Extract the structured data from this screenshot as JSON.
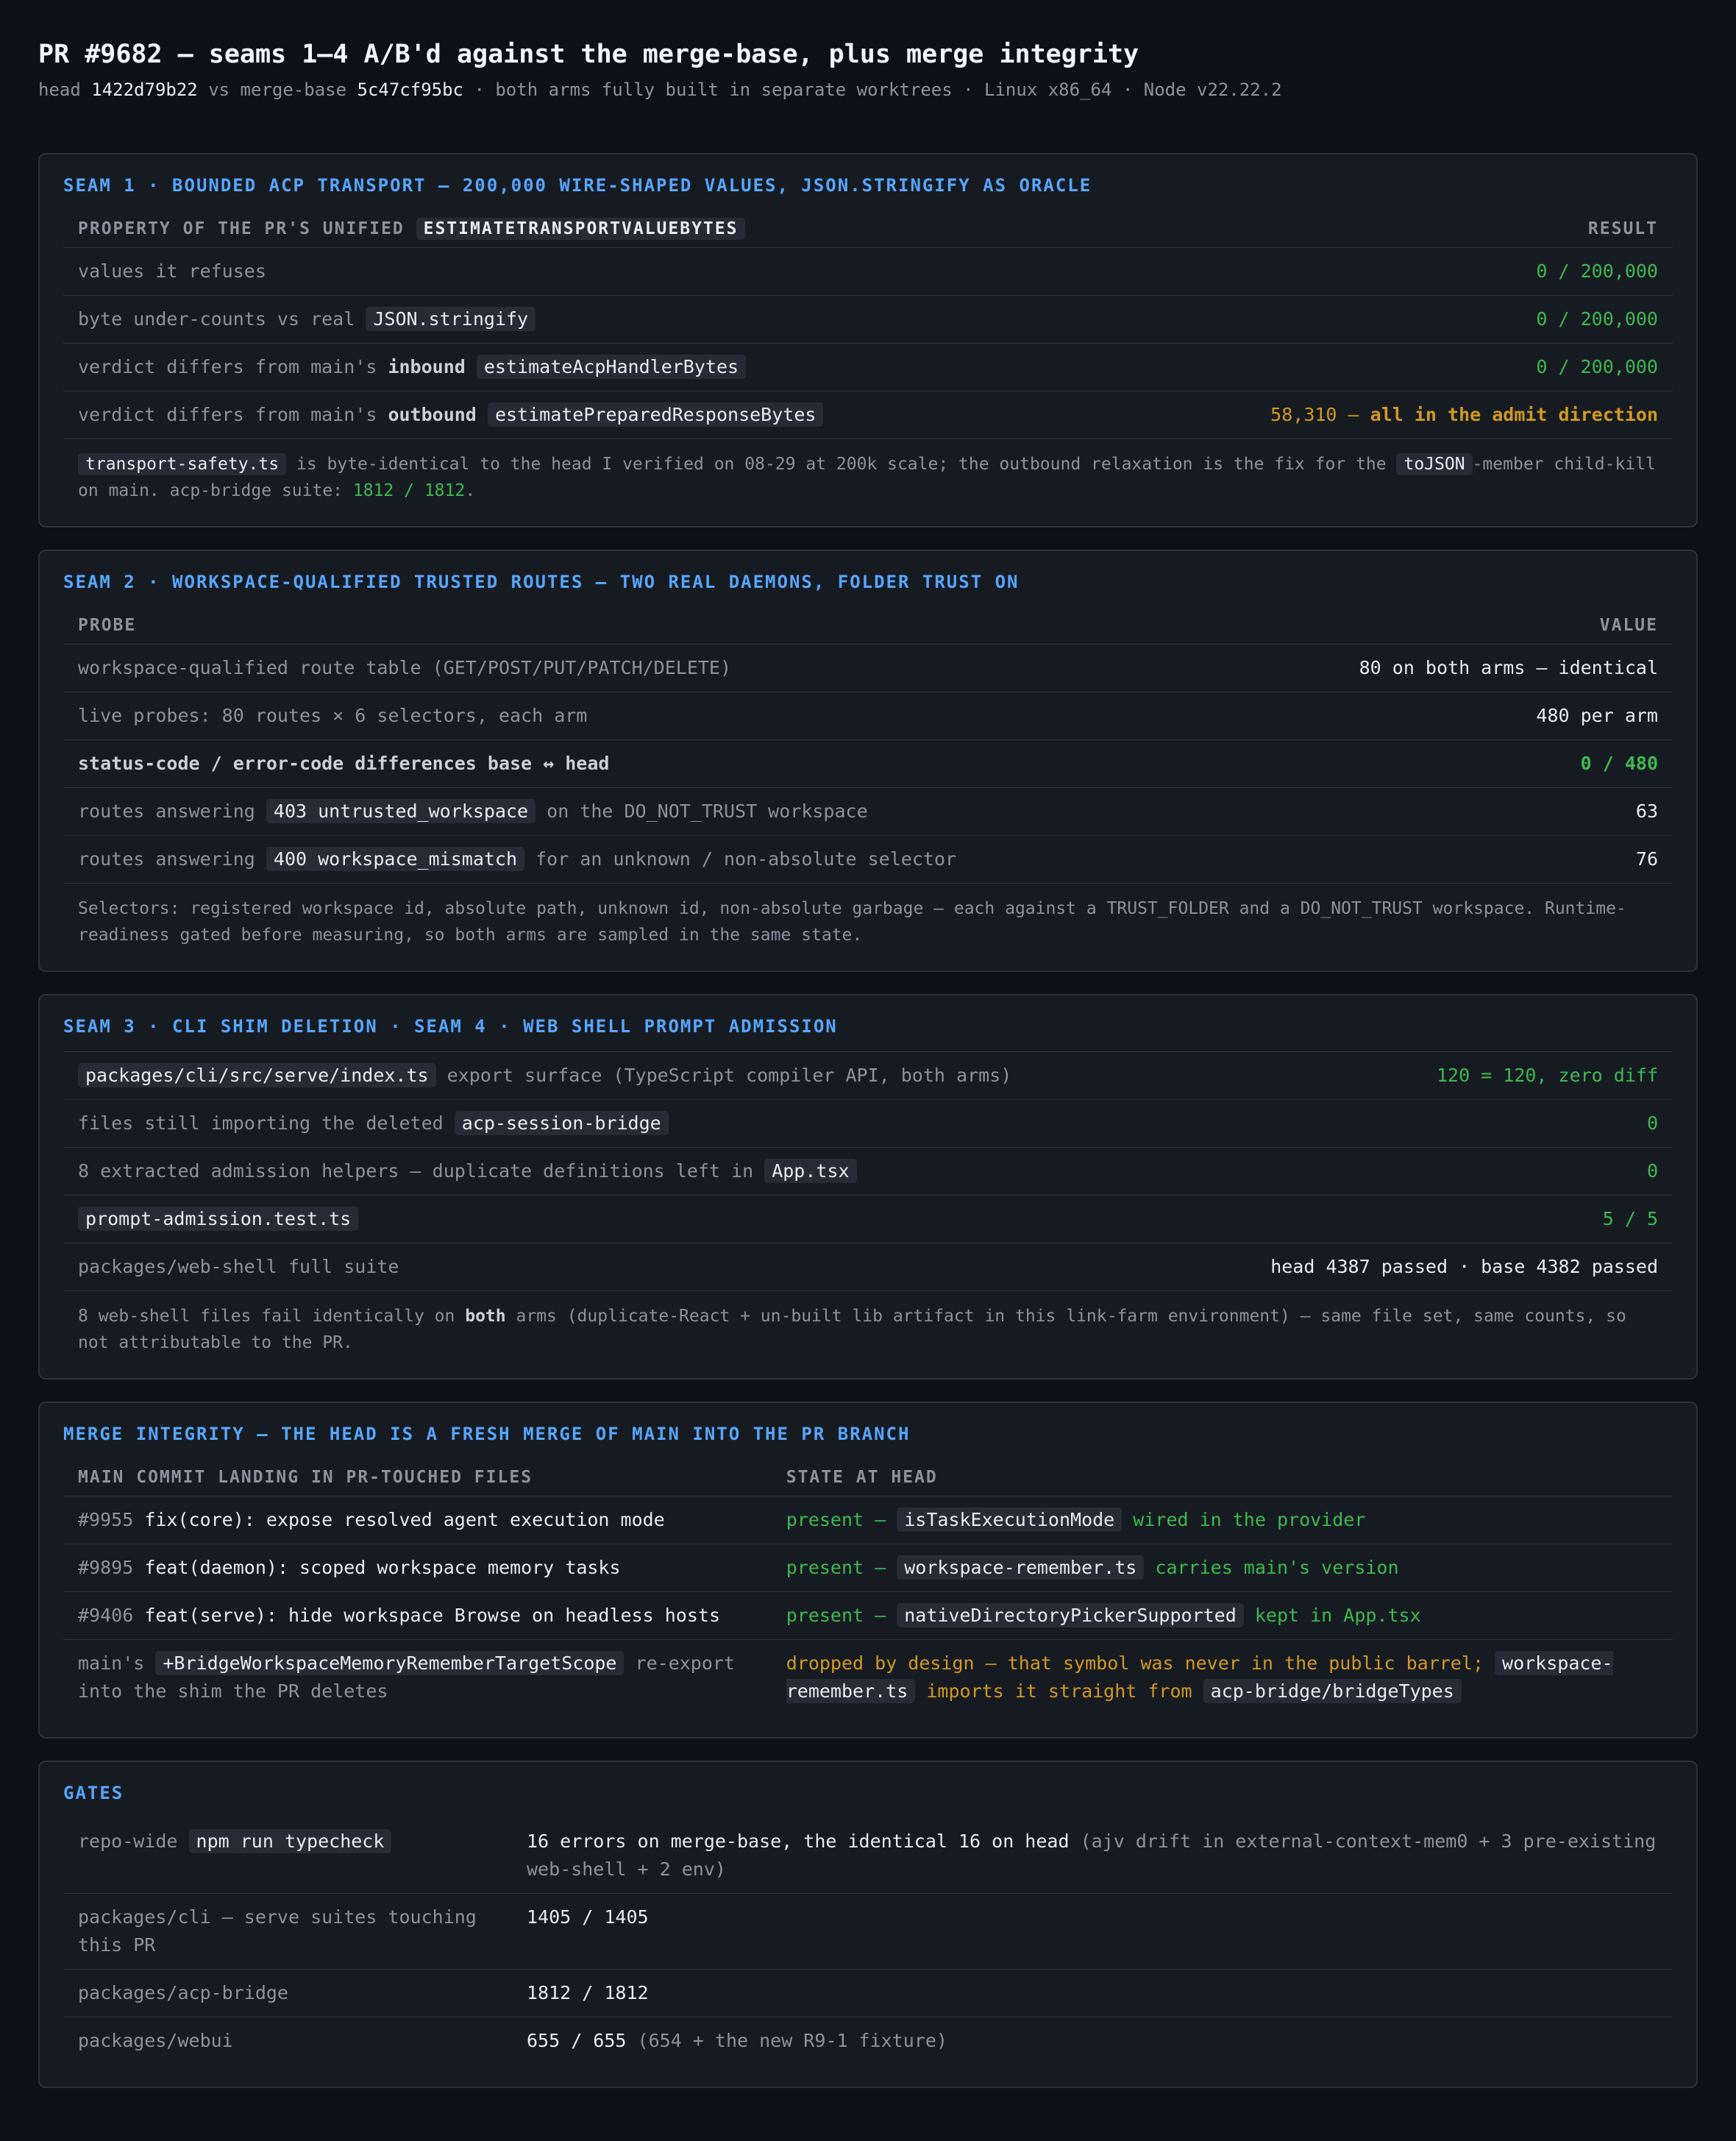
{
  "header": {
    "title": "PR #9682 — seams 1–4 A/B'd against the merge-base, plus merge integrity",
    "sub_head_label": "head",
    "head_sha": "1422d79b22",
    "sub_vs": "vs merge-base",
    "base_sha": "5c47cf95bc",
    "sub_rest": "· both arms fully built in separate worktrees · Linux x86_64 · Node v22.22.2"
  },
  "seam1": {
    "title": "Seam 1 · bounded ACP transport — 200,000 wire-shaped values, JSON.stringify as oracle",
    "col_prop_prefix": "Property of the PR's unified",
    "col_prop_code": "estimateTransportValueBytes",
    "col_result": "Result",
    "rows": [
      {
        "label": "values it refuses",
        "result": "0 / 200,000"
      },
      {
        "label": "byte under-counts vs real",
        "code": "JSON.stringify",
        "result": "0 / 200,000"
      },
      {
        "label_pre": "verdict differs from main's",
        "label_bold": "inbound",
        "code": "estimateAcpHandlerBytes",
        "result": "0 / 200,000"
      },
      {
        "label_pre": "verdict differs from main's",
        "label_bold": "outbound",
        "code": "estimatePreparedResponseBytes",
        "result_pre": "58,310 —",
        "result_bold": "all in the admit direction"
      }
    ],
    "note": {
      "code1": "transport-safety.ts",
      "text1": "is byte-identical to the head I verified on 08-29 at 200k scale; the outbound relaxation is the fix for the",
      "code2": "toJSON",
      "text2": "-member child-kill on main. acp-bridge suite:",
      "suite": "1812 / 1812",
      "end": "."
    }
  },
  "seam2": {
    "title": "Seam 2 · workspace-qualified trusted routes — two real daemons, folder trust on",
    "col_probe": "Probe",
    "col_value": "Value",
    "rows": [
      {
        "label": "workspace-qualified route table (GET/POST/PUT/PATCH/DELETE)",
        "value": "80 on both arms — identical"
      },
      {
        "label": "live probes: 80 routes × 6 selectors, each arm",
        "value": "480 per arm"
      },
      {
        "label": "status-code / error-code differences base ↔ head",
        "value": "0 / 480"
      },
      {
        "label_pre": "routes answering",
        "code": "403 untrusted_workspace",
        "label_post": "on the DO_NOT_TRUST workspace",
        "value": "63"
      },
      {
        "label_pre": "routes answering",
        "code": "400 workspace_mismatch",
        "label_post": "for an unknown / non-absolute selector",
        "value": "76"
      }
    ],
    "note": "Selectors: registered workspace id, absolute path, unknown id, non-absolute garbage — each against a TRUST_FOLDER and a DO_NOT_TRUST workspace. Runtime-readiness gated before measuring, so both arms are sampled in the same state."
  },
  "seam34": {
    "title": "Seam 3 · CLI shim deletion · Seam 4 · web shell prompt admission",
    "rows": [
      {
        "code": "packages/cli/src/serve/index.ts",
        "label_post": "export surface (TypeScript compiler API, both arms)",
        "value": "120 = 120, zero diff"
      },
      {
        "label_pre": "files still importing the deleted",
        "code": "acp-session-bridge",
        "value": "0"
      },
      {
        "label_pre": "8 extracted admission helpers — duplicate definitions left in",
        "code": "App.tsx",
        "value": "0"
      },
      {
        "code": "prompt-admission.test.ts",
        "value": "5 / 5"
      },
      {
        "label_pre": "packages/web-shell full suite",
        "value": "head 4387 passed · base 4382 passed"
      }
    ],
    "note_pre": "8 web-shell files fail identically on",
    "note_bold": "both",
    "note_post": "arms (duplicate-React + un-built lib artifact in this link-farm environment) — same file set, same counts, so not attributable to the PR."
  },
  "merge": {
    "title": "Merge integrity — the head is a fresh merge of main into the PR branch",
    "col_commit": "Main commit landing in PR-touched files",
    "col_state": "State at head",
    "rows": [
      {
        "pr": "#9955",
        "commit": "fix(core): expose resolved agent execution mode",
        "state_pre": "present —",
        "code": "isTaskExecutionMode",
        "state_post": "wired in the provider"
      },
      {
        "pr": "#9895",
        "commit": "feat(daemon): scoped workspace memory tasks",
        "state_pre": "present —",
        "code": "workspace-remember.ts",
        "state_post": "carries main's version"
      },
      {
        "pr": "#9406",
        "commit": "feat(serve): hide workspace Browse on headless hosts",
        "state_pre": "present —",
        "code": "nativeDirectoryPickerSupported",
        "state_post": "kept in App.tsx"
      }
    ],
    "last": {
      "commit_pre": "main's",
      "commit_code": "+BridgeWorkspaceMemoryRememberTargetScope",
      "commit_post": "re-export into the shim the PR deletes",
      "state_pre": "dropped by design — that symbol was never in the public barrel;",
      "state_code1": "workspace-remember.ts",
      "state_mid": "imports it straight from",
      "state_code2": "acp-bridge/bridgeTypes"
    }
  },
  "gates": {
    "title": "Gates",
    "rows": [
      {
        "label_pre": "repo-wide",
        "code": "npm run typecheck",
        "value": "16 errors on merge-base, the identical 16 on head",
        "muted": "(ajv drift in external-context-mem0 + 3 pre-existing web-shell + 2 env)"
      },
      {
        "label_pre": "packages/cli — serve suites touching this PR",
        "value": "1405 / 1405"
      },
      {
        "label_pre": "packages/acp-bridge",
        "value": "1812 / 1812"
      },
      {
        "label_pre": "packages/webui",
        "value": "655 / 655",
        "muted": "(654 + the new R9-1 fixture)"
      }
    ]
  }
}
